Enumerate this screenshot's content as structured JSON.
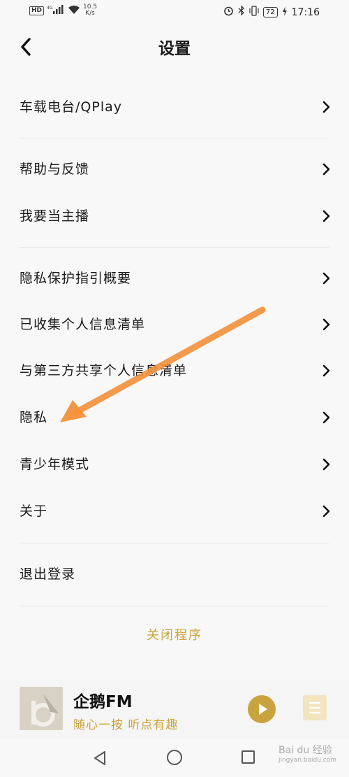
{
  "status_bar": {
    "hd": "HD",
    "signal": "4G",
    "speed_value": "10.5",
    "speed_unit": "K/s",
    "battery": "72",
    "time": "17:16"
  },
  "header": {
    "title": "设置"
  },
  "groups": [
    {
      "items": [
        {
          "label": "车载电台/QPlay"
        }
      ]
    },
    {
      "items": [
        {
          "label": "帮助与反馈"
        },
        {
          "label": "我要当主播"
        }
      ]
    },
    {
      "items": [
        {
          "label": "隐私保护指引概要"
        },
        {
          "label": "已收集个人信息清单"
        },
        {
          "label": "与第三方共享个人信息清单"
        },
        {
          "label": "隐私"
        },
        {
          "label": "青少年模式"
        },
        {
          "label": "关于"
        }
      ]
    },
    {
      "items": [
        {
          "label": "退出登录"
        }
      ]
    }
  ],
  "close_app": "关闭程序",
  "player": {
    "title": "企鹅FM",
    "subtitle": "随心一按 听点有趣"
  },
  "watermark": {
    "brand": "Bai du 经验",
    "url": "jingyan.baidu.com"
  },
  "colors": {
    "accent": "#c9a43e",
    "annotation_arrow": "#f4903a"
  }
}
